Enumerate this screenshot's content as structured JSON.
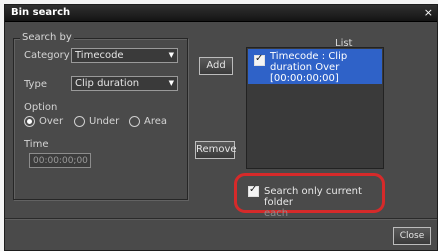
{
  "window": {
    "title": "Bin search",
    "close_glyph": "×"
  },
  "search_by": {
    "legend": "Search by",
    "category_label": "Category",
    "category_value": "Timecode",
    "type_label": "Type",
    "type_value": "Clip duration",
    "option_label": "Option",
    "options": [
      {
        "label": "Over",
        "selected": true
      },
      {
        "label": "Under",
        "selected": false
      },
      {
        "label": "Area",
        "selected": false
      }
    ],
    "time_label": "Time",
    "time_value": "00:00:00;00"
  },
  "buttons": {
    "add": "Add",
    "remove": "Remove",
    "close": "Close"
  },
  "list": {
    "title": "List",
    "items": [
      {
        "text": "Timecode : Clip duration Over [00:00:00;00]",
        "checked": true,
        "selected": true
      }
    ]
  },
  "only_current_folder": {
    "label": "Search only current folder",
    "label_cont": "each",
    "checked": true
  },
  "colors": {
    "highlight_ring": "#d62a2a",
    "selection": "#2f62c8",
    "dialog_bg": "#4a4a4a"
  }
}
